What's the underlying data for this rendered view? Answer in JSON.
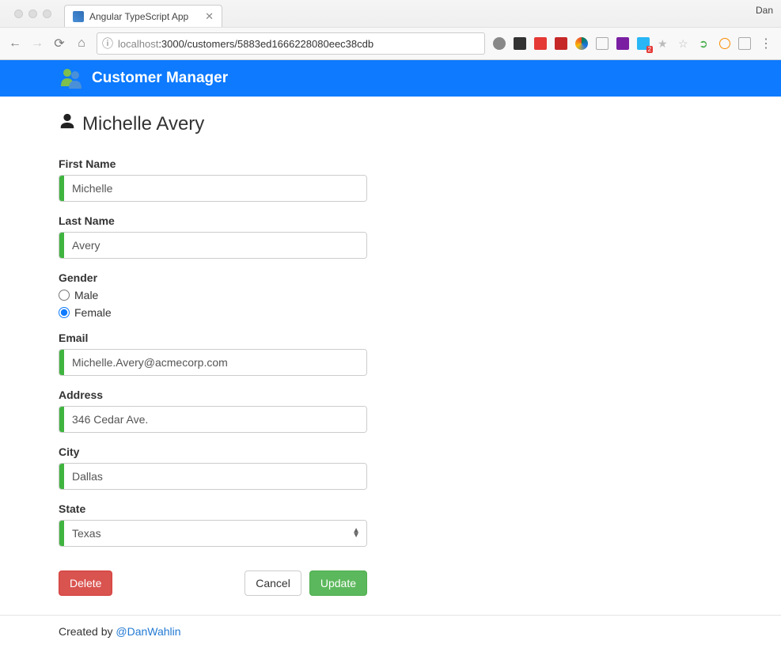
{
  "browser": {
    "tab_title": "Angular TypeScript App",
    "profile": "Dan",
    "url_host": "localhost",
    "url_port_path": ":3000/customers/5883ed1666228080eec38cdb"
  },
  "header": {
    "title": "Customer Manager"
  },
  "page": {
    "title": "Michelle Avery"
  },
  "form": {
    "first_name_label": "First Name",
    "first_name": "Michelle",
    "last_name_label": "Last Name",
    "last_name": "Avery",
    "gender_label": "Gender",
    "gender_option_male": "Male",
    "gender_option_female": "Female",
    "gender_selected": "Female",
    "email_label": "Email",
    "email": "Michelle.Avery@acmecorp.com",
    "address_label": "Address",
    "address": "346 Cedar Ave.",
    "city_label": "City",
    "city": "Dallas",
    "state_label": "State",
    "state": "Texas"
  },
  "buttons": {
    "delete": "Delete",
    "cancel": "Cancel",
    "update": "Update"
  },
  "footer": {
    "created_by": "Created by ",
    "author_handle": "@DanWahlin"
  }
}
